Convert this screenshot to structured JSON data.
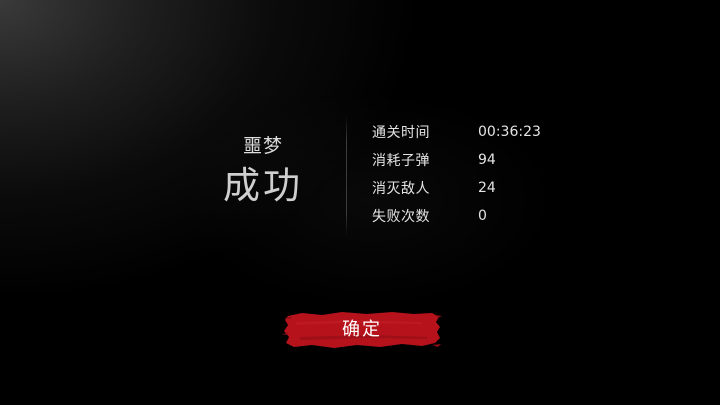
{
  "result": {
    "difficulty": "噩梦",
    "outcome": "成功"
  },
  "stats": [
    {
      "label": "通关时间",
      "value": "00:36:23"
    },
    {
      "label": "消耗子弹",
      "value": "94"
    },
    {
      "label": "消灭敌人",
      "value": "24"
    },
    {
      "label": "失败次数",
      "value": "0"
    }
  ],
  "confirm_button": {
    "label": "确定",
    "color": "#b5121b"
  }
}
